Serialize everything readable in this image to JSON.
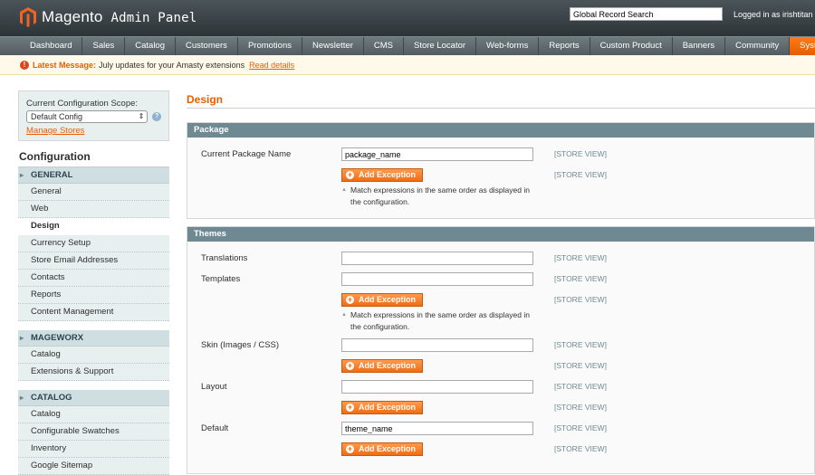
{
  "header": {
    "brand": "Magento",
    "subtitle": "Admin Panel",
    "search_value": "Global Record Search",
    "logged_in": "Logged in as irishtitan"
  },
  "nav": {
    "items": [
      "Dashboard",
      "Sales",
      "Catalog",
      "Customers",
      "Promotions",
      "Newsletter",
      "CMS",
      "Store Locator",
      "Web-forms",
      "Reports",
      "Custom Product",
      "Banners",
      "Community",
      "System"
    ],
    "active": "System"
  },
  "message": {
    "label": "Latest Message:",
    "text": "July updates for your Amasty extensions",
    "link": "Read details"
  },
  "sidebar": {
    "scope_label": "Current Configuration Scope:",
    "scope_value": "Default Config",
    "manage_stores": "Manage Stores",
    "config_title": "Configuration",
    "sections": [
      {
        "title": "GENERAL",
        "items": [
          "General",
          "Web",
          "Design",
          "Currency Setup",
          "Store Email Addresses",
          "Contacts",
          "Reports",
          "Content Management"
        ]
      },
      {
        "title": "MAGEWORX",
        "items": [
          "Catalog",
          "Extensions & Support"
        ]
      },
      {
        "title": "CATALOG",
        "items": [
          "Catalog",
          "Configurable Swatches",
          "Inventory",
          "Google Sitemap"
        ]
      }
    ],
    "active_item": "Design"
  },
  "main": {
    "title": "Design",
    "package": {
      "head": "Package",
      "label": "Current Package Name",
      "value": "package_name",
      "scope": "[STORE VIEW]",
      "add_label": "Add Exception",
      "note": "Match expressions in the same order as displayed in the configuration."
    },
    "themes": {
      "head": "Themes",
      "translations_label": "Translations",
      "templates_label": "Templates",
      "skin_label": "Skin (Images / CSS)",
      "layout_label": "Layout",
      "default_label": "Default",
      "default_value": "theme_name",
      "scope": "[STORE VIEW]",
      "add_label": "Add Exception",
      "note": "Match expressions in the same order as displayed in the configuration."
    }
  }
}
